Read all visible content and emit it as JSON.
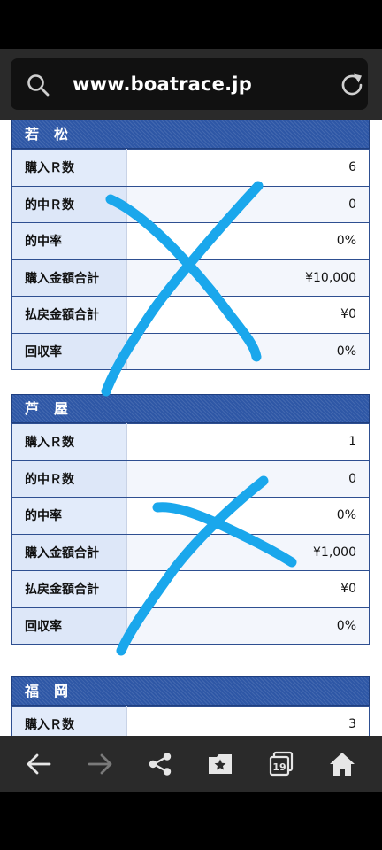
{
  "browser": {
    "url": "www.boatrace.jp"
  },
  "sections": [
    {
      "name": "若　松",
      "rows": [
        {
          "label": "購入Ｒ数",
          "value": "6"
        },
        {
          "label": "的中Ｒ数",
          "value": "0"
        },
        {
          "label": "的中率",
          "value": "0%"
        },
        {
          "label": "購入金額合計",
          "value": "¥10,000"
        },
        {
          "label": "払戻金額合計",
          "value": "¥0"
        },
        {
          "label": "回収率",
          "value": "0%"
        }
      ]
    },
    {
      "name": "芦　屋",
      "rows": [
        {
          "label": "購入Ｒ数",
          "value": "1"
        },
        {
          "label": "的中Ｒ数",
          "value": "0"
        },
        {
          "label": "的中率",
          "value": "0%"
        },
        {
          "label": "購入金額合計",
          "value": "¥1,000"
        },
        {
          "label": "払戻金額合計",
          "value": "¥0"
        },
        {
          "label": "回収率",
          "value": "0%"
        }
      ]
    },
    {
      "name": "福　岡",
      "rows": [
        {
          "label": "購入Ｒ数",
          "value": "3"
        }
      ]
    }
  ],
  "toolbar": {
    "tabs_count": "19",
    "icons": [
      "back-arrow-icon",
      "forward-arrow-icon",
      "share-icon",
      "bookmarks-icon",
      "tabs-icon",
      "home-icon"
    ]
  },
  "colors": {
    "header_blue": "#2e57a6",
    "label_bg": "#e2ebfa",
    "marker_blue": "#1aa7ec"
  }
}
